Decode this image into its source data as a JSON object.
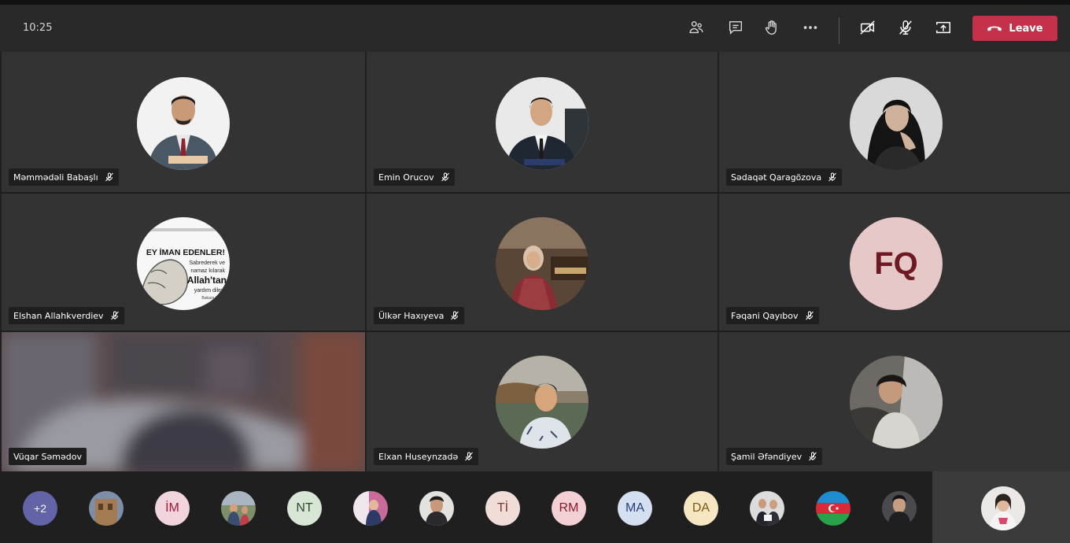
{
  "header": {
    "time": "10:25",
    "leave_label": "Leave",
    "icons": [
      "people-icon",
      "chat-icon",
      "raise-hand-icon",
      "more-icon",
      "camera-off-icon",
      "mic-off-icon",
      "share-tray-icon",
      "phone-icon"
    ]
  },
  "tiles": [
    {
      "name": "Məmmədəli Babaşlı",
      "muted": true
    },
    {
      "name": "Emin Orucov",
      "muted": true
    },
    {
      "name": "Sədaqət Qaragözova",
      "muted": true
    },
    {
      "name": "Elshan Allahkverdiev",
      "muted": true
    },
    {
      "name": "Ülkər Haxıyeva",
      "muted": true
    },
    {
      "name": "Fəqani Qayıbov",
      "muted": true,
      "initials": "FQ"
    },
    {
      "name": "Vüqar Səmədov",
      "muted": false
    },
    {
      "name": "Elxan Huseynzadə",
      "muted": true
    },
    {
      "name": "Şamil Əfəndiyev",
      "muted": true
    }
  ],
  "poster": {
    "line1": "EY İMAN EDENLER!",
    "line2": "Sabrederek ve",
    "line3": "namaz kılarak",
    "line4": "Allah'tan",
    "line5": "yardım dileyi",
    "line6": "Bakara,153"
  },
  "roster": {
    "overflow": "+2",
    "initials": [
      "İM",
      "NT",
      "Tİ",
      "RM",
      "MA",
      "DA"
    ]
  },
  "colors": {
    "leave": "#c4314b",
    "overflow_chip": "#6264a7",
    "tile_bg": "#333333",
    "fq_bg": "#e6c8c8",
    "fq_text": "#6e1a22"
  }
}
